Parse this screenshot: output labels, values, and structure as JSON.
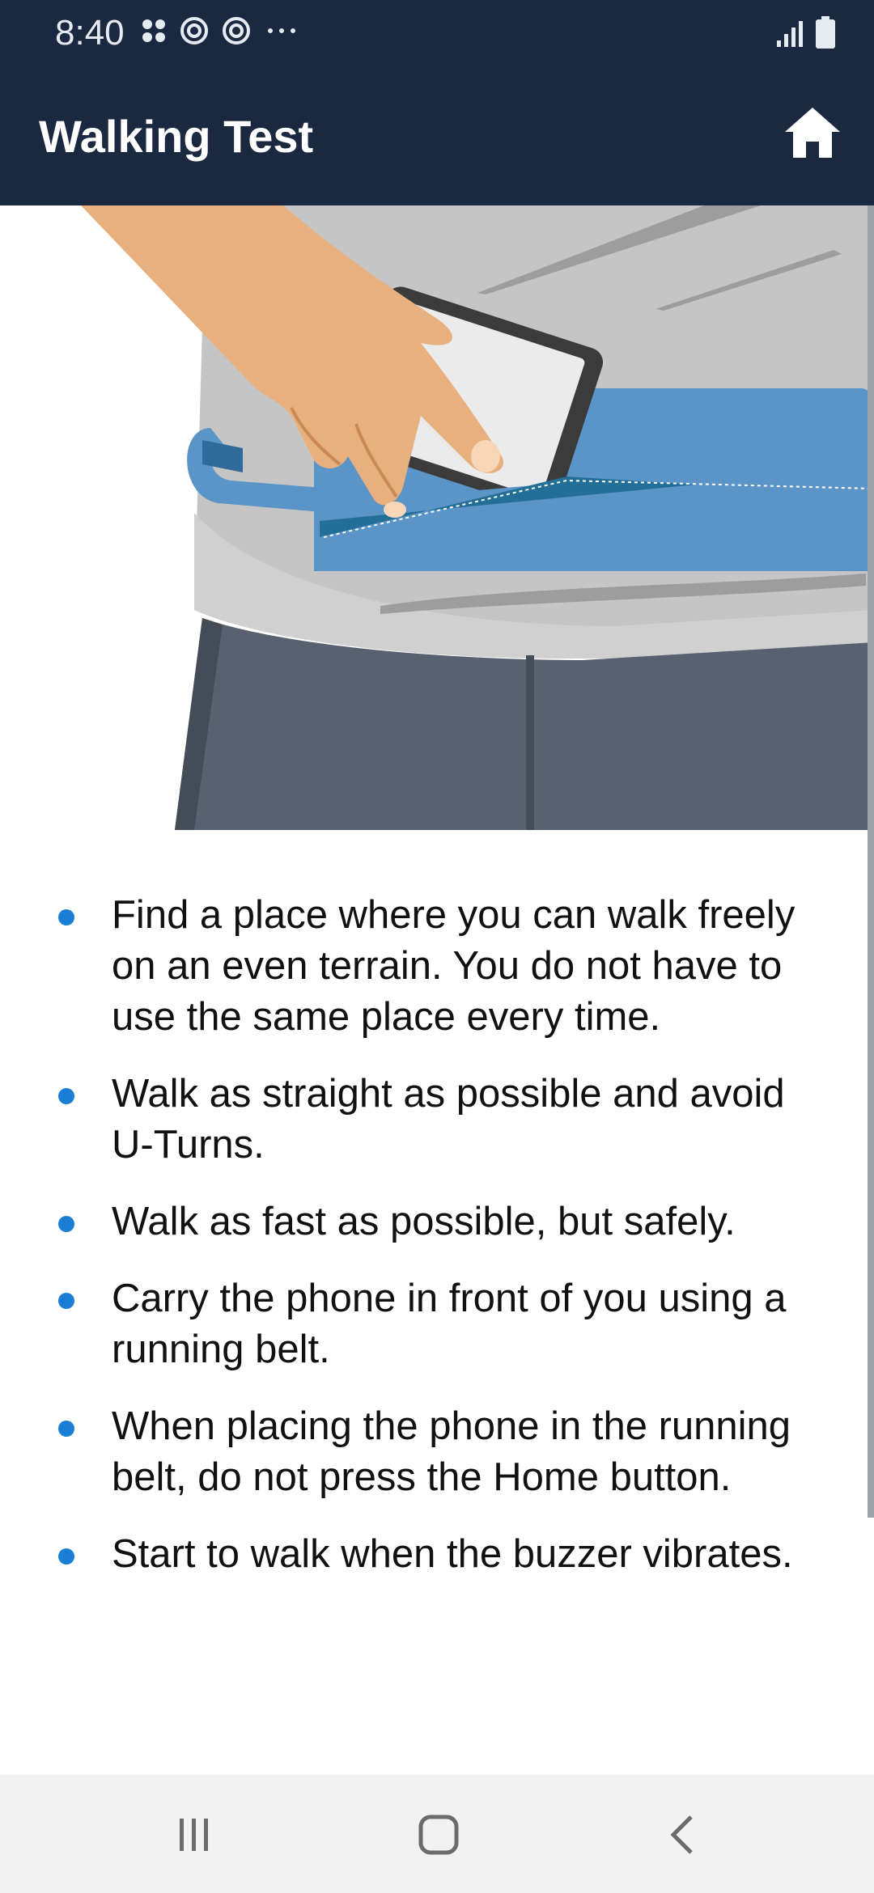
{
  "status_bar": {
    "time": "8:40",
    "notification_icons": [
      "apps-icon",
      "sync-icon",
      "sync-icon",
      "more-icon"
    ],
    "system_icons": [
      "signal-icon",
      "battery-icon"
    ]
  },
  "app_bar": {
    "title": "Walking Test",
    "home_icon": "home-icon",
    "background_color": "#1a2840"
  },
  "hero_image": {
    "description_icon": "hand-placing-phone-in-running-belt-illustration"
  },
  "instructions": [
    "Find a place where you can walk freely on an even terrain. You do not have to use the same place every time.",
    "Walk as straight as possible and avoid U-Turns.",
    "Walk as fast as possible, but safely.",
    "Carry the phone in front of you using a running belt.",
    "When placing the phone in the running belt, do not press the Home button.",
    "Start to walk when the buzzer vibrates."
  ],
  "colors": {
    "accent": "#1a7fd4",
    "belt": "#5b94c6",
    "pants": "#58616f",
    "shirt": "#c4c4c4"
  },
  "nav_bar": {
    "icons": [
      "recent-apps-icon",
      "home-nav-icon",
      "back-icon"
    ]
  }
}
